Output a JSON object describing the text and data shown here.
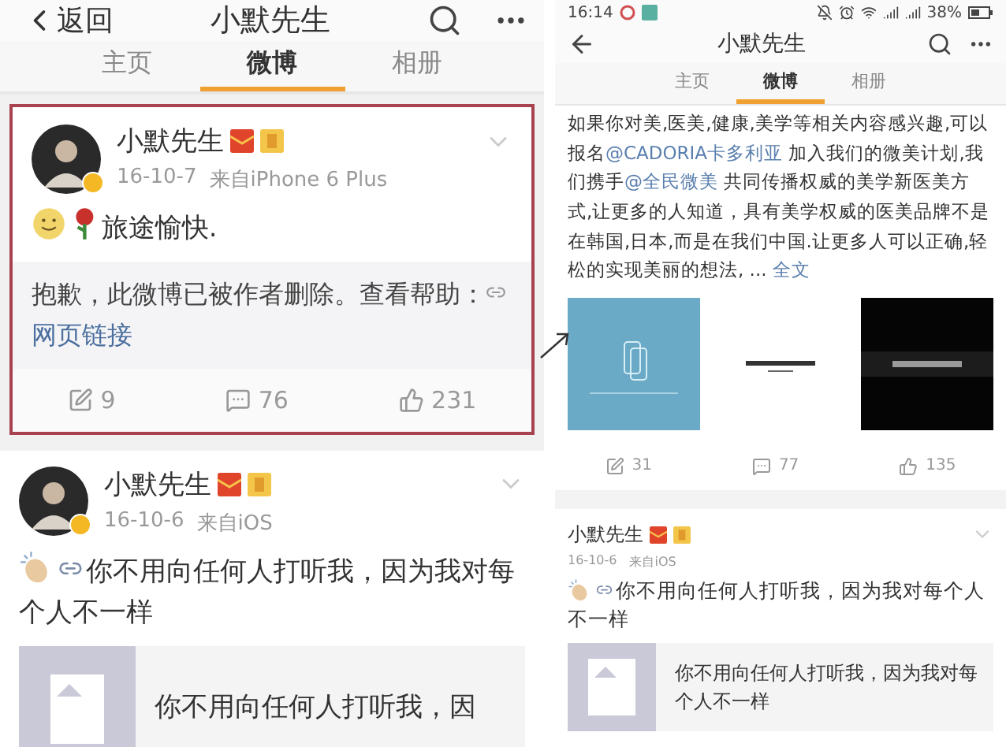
{
  "left": {
    "header": {
      "back": "返回",
      "title": "小默先生"
    },
    "tabs": [
      {
        "label": "主页",
        "selected": false
      },
      {
        "label": "微博",
        "selected": true
      },
      {
        "label": "相册",
        "selected": false
      }
    ],
    "posts": [
      {
        "highlighted": true,
        "name": "小默先生",
        "date": "16-10-7",
        "source": "来自iPhone 6 Plus",
        "body": [
          {
            "kind": "smiley"
          },
          {
            "kind": "rose"
          },
          {
            "kind": "text",
            "text": "旅途愉快."
          }
        ],
        "notice": {
          "text": "抱歉，此微博已被作者删除。查看帮助：",
          "link": "网页链接"
        },
        "actions": {
          "reposts": "9",
          "comments": "76",
          "likes": "231"
        }
      },
      {
        "highlighted": false,
        "name": "小默先生",
        "date": "16-10-6",
        "source": "来自iOS",
        "body": [
          {
            "kind": "clap"
          },
          {
            "kind": "link"
          },
          {
            "kind": "text",
            "text": "你不用向任何人打听我，因为我对每个人不一样"
          }
        ],
        "card": {
          "text": "你不用向任何人打听我，因"
        }
      }
    ]
  },
  "right": {
    "status_bar": {
      "time": "16:14",
      "battery": "38%"
    },
    "header": {
      "title": "小默先生"
    },
    "tabs": [
      {
        "label": "主页",
        "selected": false
      },
      {
        "label": "微博",
        "selected": true
      },
      {
        "label": "相册",
        "selected": false
      }
    ],
    "posts": [
      {
        "body": [
          {
            "kind": "text",
            "text": "如果你对美,医美,健康,美学等相关内容感兴趣,可以报名"
          },
          {
            "kind": "mention",
            "text": "@CADORIA卡多利亚"
          },
          {
            "kind": "text",
            "text": " 加入我们的微美计划,我们携手"
          },
          {
            "kind": "mention",
            "text": "@全民微美"
          },
          {
            "kind": "text",
            "text": " 共同传播权威的美学新医美方式,让更多的人知道，具有美学权威的医美品牌不是在韩国,日本,而是在我们中国.让更多人可以正确,轻松的实现美丽的想法, ... "
          },
          {
            "kind": "mention",
            "text": "全文"
          }
        ],
        "actions": {
          "reposts": "31",
          "comments": "77",
          "likes": "135"
        }
      },
      {
        "name": "小默先生",
        "date": "16-10-6",
        "source": "来自iOS",
        "body": [
          {
            "kind": "clap"
          },
          {
            "kind": "link"
          },
          {
            "kind": "text",
            "text": "你不用向任何人打听我，因为我对每个人不一样"
          }
        ],
        "card": {
          "text": "你不用向任何人打听我，因为我对每个人不一样"
        }
      }
    ]
  }
}
